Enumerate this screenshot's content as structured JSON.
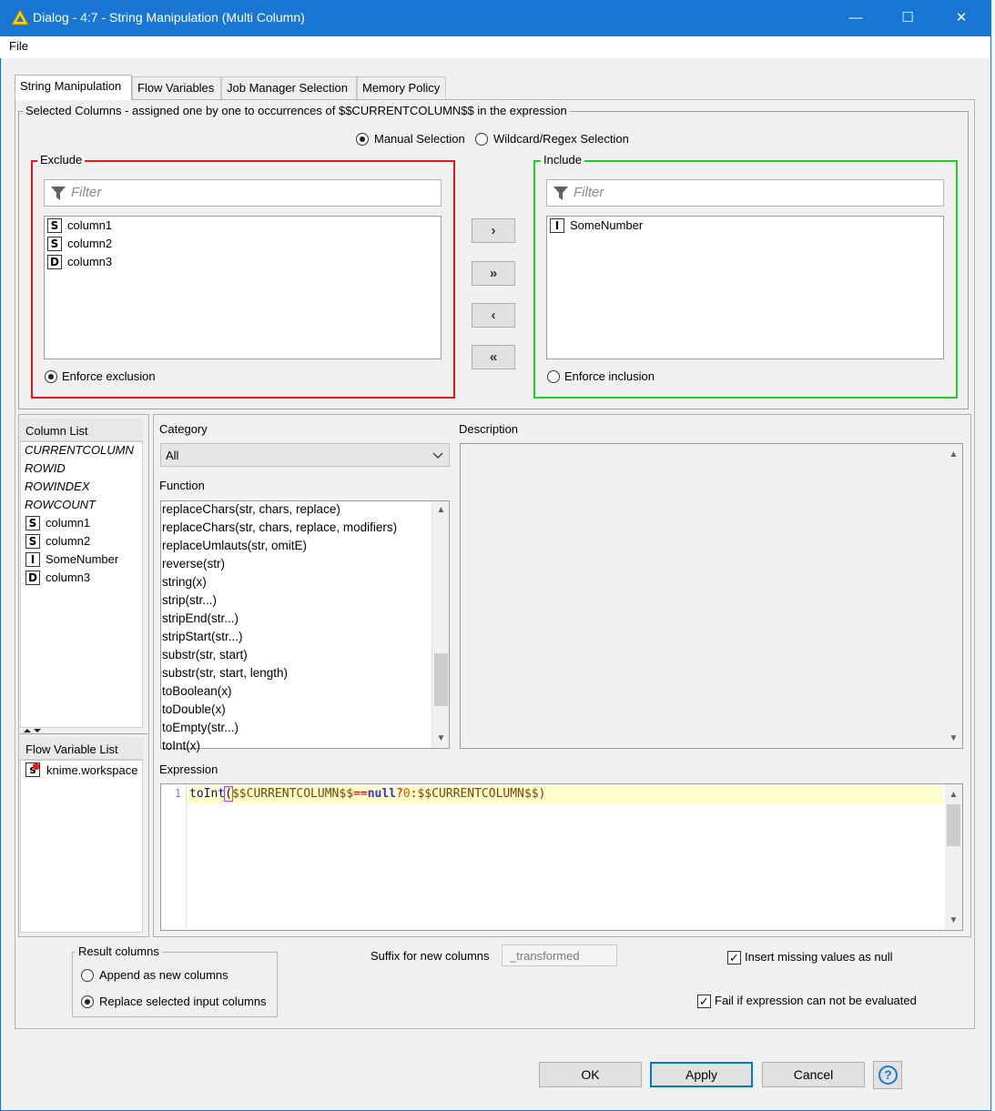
{
  "window": {
    "title": "Dialog - 4:7 - String Manipulation (Multi Column)",
    "minimize": "—",
    "maximize": "☐",
    "close": "✕"
  },
  "menu": {
    "file": "File"
  },
  "tabs": [
    {
      "label": "String Manipulation",
      "active": true
    },
    {
      "label": "Flow Variables"
    },
    {
      "label": "Job Manager Selection"
    },
    {
      "label": "Memory Policy"
    }
  ],
  "selected_columns": {
    "title": "Selected Columns - assigned one by one to occurrences of $$CURRENTCOLUMN$$ in the expression",
    "manual_selection": "Manual Selection",
    "wildcard_selection": "Wildcard/Regex Selection",
    "exclude": {
      "title": "Exclude",
      "filter_placeholder": "Filter",
      "items": [
        {
          "type": "S",
          "name": "column1"
        },
        {
          "type": "S",
          "name": "column2"
        },
        {
          "type": "D",
          "name": "column3"
        }
      ],
      "enforce": "Enforce exclusion"
    },
    "include": {
      "title": "Include",
      "filter_placeholder": "Filter",
      "items": [
        {
          "type": "I",
          "name": "SomeNumber"
        }
      ],
      "enforce": "Enforce inclusion"
    },
    "buttons": {
      "add": "›",
      "add_all": "»",
      "remove": "‹",
      "remove_all": "«"
    }
  },
  "column_list": {
    "title": "Column List",
    "special": [
      "CURRENTCOLUMN",
      "ROWID",
      "ROWINDEX",
      "ROWCOUNT"
    ],
    "columns": [
      {
        "type": "S",
        "name": "column1"
      },
      {
        "type": "S",
        "name": "column2"
      },
      {
        "type": "I",
        "name": "SomeNumber"
      },
      {
        "type": "D",
        "name": "column3"
      }
    ]
  },
  "flow_variable_list": {
    "title": "Flow Variable List",
    "items": [
      {
        "type": "s",
        "name": "knime.workspace"
      }
    ]
  },
  "category": {
    "label": "Category",
    "value": "All"
  },
  "function": {
    "label": "Function",
    "items": [
      "replaceChars(str, chars, replace)",
      "replaceChars(str, chars, replace, modifiers)",
      "replaceUmlauts(str, omitE)",
      "reverse(str)",
      "string(x)",
      "strip(str...)",
      "stripEnd(str...)",
      "stripStart(str...)",
      "substr(str, start)",
      "substr(str, start, length)",
      "toBoolean(x)",
      "toDouble(x)",
      "toEmpty(str...)",
      "toInt(x)"
    ]
  },
  "description": {
    "label": "Description"
  },
  "expression": {
    "label": "Expression",
    "line_number": "1",
    "tokens": {
      "fn": "toInt",
      "open": "(",
      "col1": "$$CURRENTCOLUMN$$",
      "op": "==",
      "kw": "null",
      "q": "?",
      "num": "0",
      "colon": ":",
      "col2": "$$CURRENTCOLUMN$$",
      "close": ")"
    }
  },
  "result_columns": {
    "title": "Result columns",
    "append": "Append as new columns",
    "replace": "Replace selected input columns",
    "selected": "replace"
  },
  "suffix": {
    "label": "Suffix for new columns",
    "value": "_transformed"
  },
  "options": {
    "insert_missing": {
      "label": "Insert missing values as null",
      "checked": true
    },
    "fail_if": {
      "label": "Fail if expression can not be evaluated",
      "checked": true
    }
  },
  "footer": {
    "ok": "OK",
    "apply": "Apply",
    "cancel": "Cancel",
    "help": "?"
  },
  "colors": {
    "titlebar": "#1976d2",
    "exclude_border": "#e8151b",
    "include_border": "#22cc22",
    "expr_highlight": "#ffffcc",
    "fn_color": "#0000c0",
    "col_color": "#804000",
    "keyword_color": "#3333cc",
    "number_color": "#d06000"
  }
}
